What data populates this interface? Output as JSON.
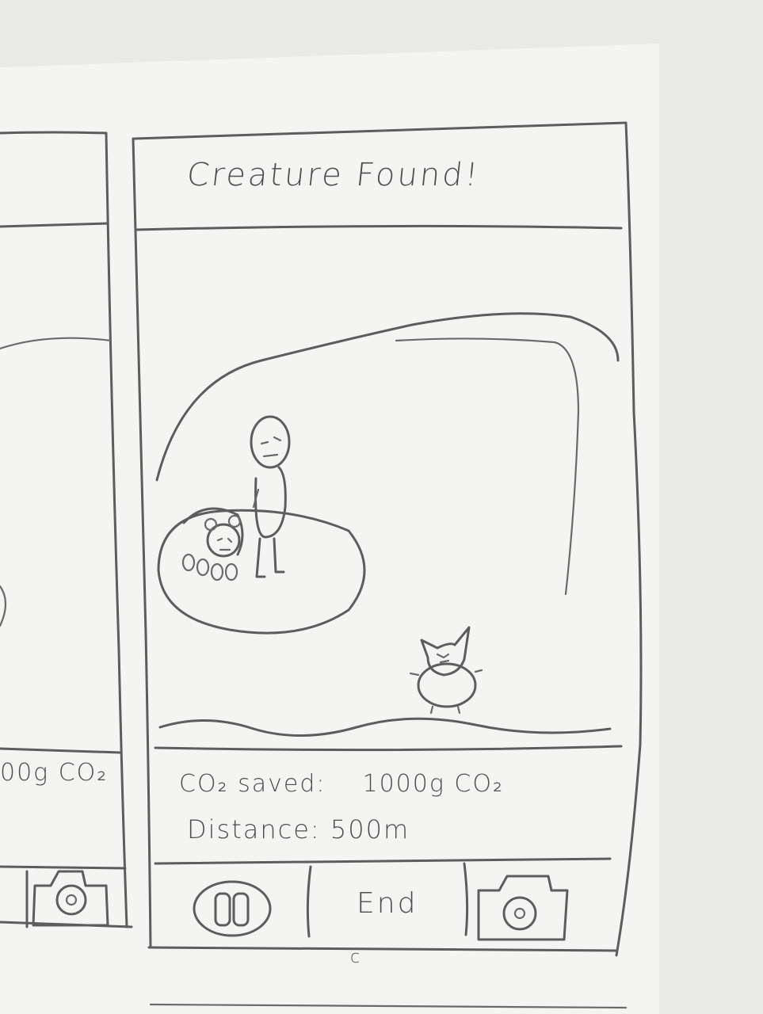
{
  "screen": {
    "title": "Creature Found!",
    "stats": {
      "co2_label": "CO₂ saved:",
      "co2_value": "1000g CO₂",
      "distance_label": "Distance:",
      "distance_value": "500m"
    },
    "toolbar": {
      "pause_icon": "pause-icon",
      "end_label": "End",
      "camera_icon": "camera-icon"
    },
    "bottom_mark": "c"
  },
  "previous_screen": {
    "co2_fragment": "00g CO₂",
    "camera_icon": "camera-icon"
  },
  "colors": {
    "paper": "#f4f4f3",
    "pencil": "#5d5d5d",
    "background": "#e9e9e7"
  }
}
